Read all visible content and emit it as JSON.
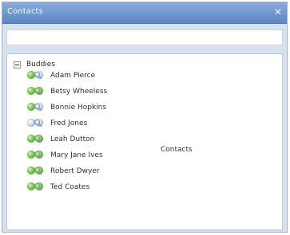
{
  "window": {
    "title": "Contacts"
  },
  "tree": {
    "group_label": "Buddies",
    "contacts": [
      {
        "label": "Adam Pierce",
        "status_left": "green",
        "status_right": "blue"
      },
      {
        "label": "Betsy Wheeless",
        "status_left": "green",
        "status_right": "green"
      },
      {
        "label": "Bonnie Hopkins",
        "status_left": "green",
        "status_right": "blue"
      },
      {
        "label": "Fred Jones",
        "status_left": "blue",
        "status_right": "blue"
      },
      {
        "label": "Leah Dutton",
        "status_left": "green",
        "status_right": "green"
      },
      {
        "label": "Mary Jane Ives",
        "status_left": "green",
        "status_right": "green"
      },
      {
        "label": "Robert Dwyer",
        "status_left": "green",
        "status_right": "green"
      },
      {
        "label": "Ted Coates",
        "status_left": "green",
        "status_right": "green"
      }
    ]
  },
  "panel": {
    "side_label": "Contacts"
  },
  "icons": {
    "close": "close-icon",
    "tree_toggle": "tree-toggle-icon",
    "status": "presence-status-icon",
    "search": "magnifier-icon"
  },
  "colors": {
    "titlebar": "#6e97d0",
    "window": "#d7e2f1",
    "border": "#9fb3cf"
  }
}
